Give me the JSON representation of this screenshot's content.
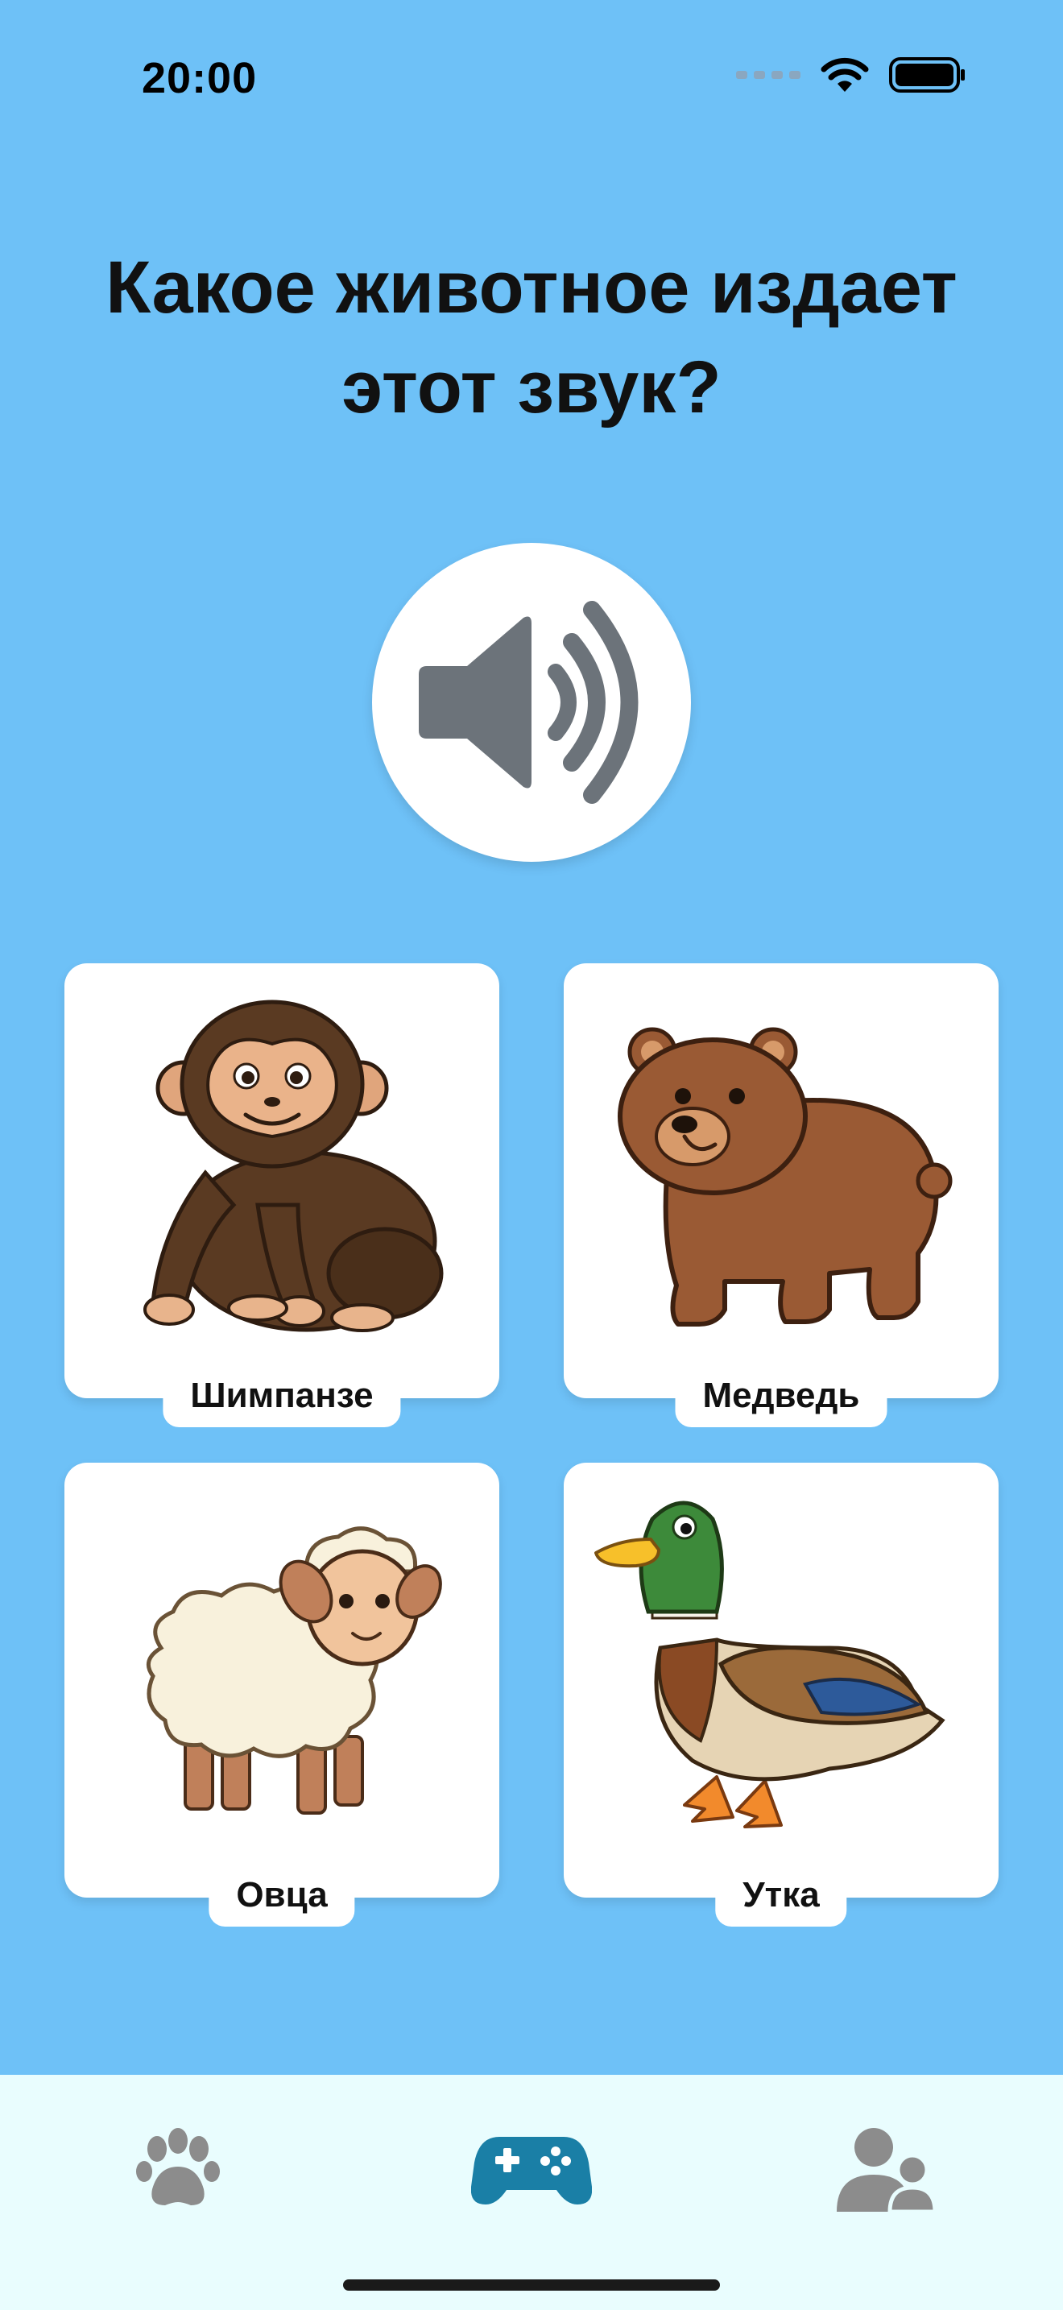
{
  "status": {
    "time": "20:00"
  },
  "question": "Какое животное издает этот звук?",
  "sound_button": {
    "icon": "speaker-icon"
  },
  "options": [
    {
      "label": "Шимпанзе",
      "icon": "chimpanzee"
    },
    {
      "label": "Медведь",
      "icon": "bear"
    },
    {
      "label": "Овца",
      "icon": "sheep"
    },
    {
      "label": "Утка",
      "icon": "duck"
    }
  ],
  "tabbar": {
    "items": [
      {
        "icon": "paw-icon",
        "active": false
      },
      {
        "icon": "gamepad-icon",
        "active": true
      },
      {
        "icon": "users-icon",
        "active": false
      }
    ],
    "active_color": "#1a7fa6",
    "inactive_color": "#8c8c8c"
  },
  "colors": {
    "background": "#6ec1f7",
    "tabbar": "#e9fdfe"
  }
}
